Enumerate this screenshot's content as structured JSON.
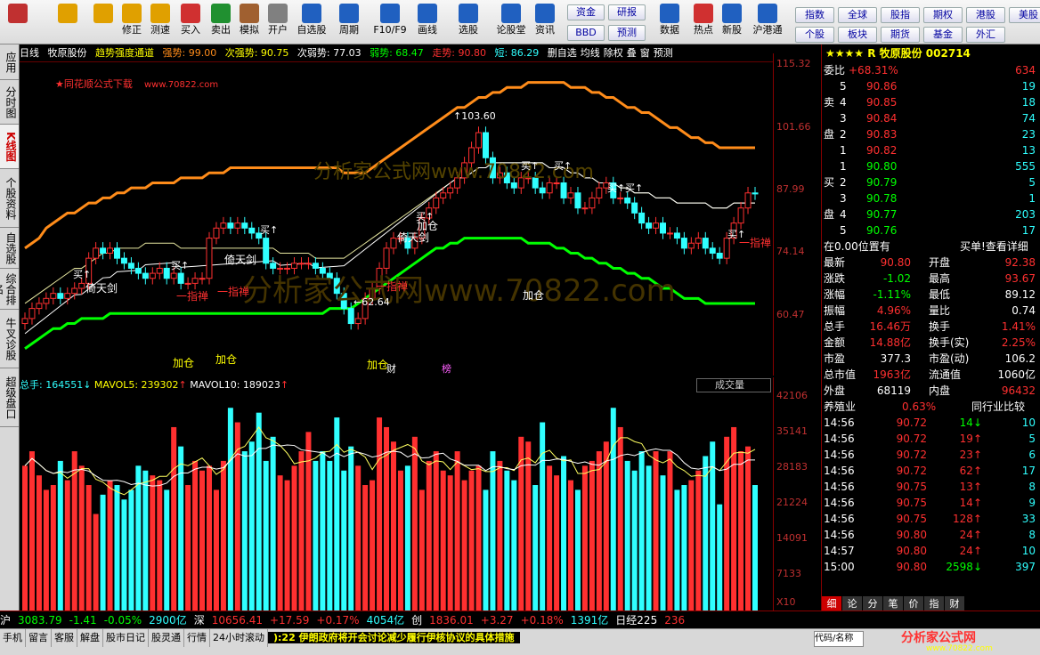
{
  "colors": {
    "up": "#ff3030",
    "down": "#30ffff",
    "green": "#00ff00",
    "yellow": "#ffff00",
    "orange": "#ff8c1a",
    "white": "#ffffff"
  },
  "toolbar": {
    "buttons": [
      {
        "id": "logo",
        "label": "",
        "icon": "logo-icon",
        "color": "#c03030"
      },
      {
        "id": "back",
        "label": "",
        "icon": "back-arrow-icon",
        "color": "#e0a000"
      },
      {
        "id": "updown",
        "label": "",
        "icon": "up-down-icon",
        "color": "#e0a000"
      },
      {
        "id": "repair",
        "label": "修正",
        "icon": "repair-icon",
        "color": "#e0a000"
      },
      {
        "id": "speedtest",
        "label": "测速",
        "icon": "clock-icon",
        "color": "#e0a000"
      },
      {
        "id": "buy",
        "label": "买入",
        "icon": "buy-icon",
        "color": "#d03030"
      },
      {
        "id": "sell",
        "label": "卖出",
        "icon": "sell-icon",
        "color": "#209030"
      },
      {
        "id": "simulate",
        "label": "模拟",
        "icon": "hammer-icon",
        "color": "#a06030"
      },
      {
        "id": "open",
        "label": "开户",
        "icon": "lock-icon",
        "color": "#808080"
      },
      {
        "id": "watchlist",
        "label": "自选股",
        "icon": "star-icon",
        "color": "#2060c0"
      },
      {
        "id": "period",
        "label": "周期",
        "icon": "clock-icon",
        "color": "#2060c0"
      },
      {
        "id": "f10",
        "label": "F10/F9",
        "icon": "f10-icon",
        "color": "#2060c0"
      },
      {
        "id": "draw",
        "label": "画线",
        "icon": "pen-icon",
        "color": "#2060c0"
      },
      {
        "id": "select",
        "label": "选股",
        "icon": "select-icon",
        "color": "#2060c0"
      },
      {
        "id": "discuss",
        "label": "论股堂",
        "icon": "discuss-icon",
        "color": "#2060c0"
      },
      {
        "id": "info",
        "label": "资讯",
        "icon": "info-icon",
        "color": "#2060c0"
      },
      {
        "id": "data",
        "label": "数据",
        "icon": "pe-icon",
        "color": "#2060c0"
      },
      {
        "id": "hot",
        "label": "热点",
        "icon": "fire-icon",
        "color": "#d03030"
      },
      {
        "id": "newshare",
        "label": "新股",
        "icon": "newshare-icon",
        "color": "#2060c0"
      },
      {
        "id": "hkconnect",
        "label": "沪港通",
        "icon": "hk-icon",
        "color": "#2060c0"
      }
    ],
    "mid_buttons": [
      "资金",
      "研报",
      "BBD",
      "预测"
    ],
    "right_buttons": [
      "指数",
      "全球",
      "股指",
      "期权",
      "港股",
      "美股",
      "个股",
      "板块",
      "期货",
      "基金",
      "外汇"
    ]
  },
  "sidebar": {
    "tabs": [
      "应用",
      "分时图",
      "K线图",
      "个股资料",
      "自选股",
      "综合排名",
      "牛叉诊股",
      "超级盘口"
    ],
    "active": 2
  },
  "infobar": {
    "period": "日线",
    "stock": "牧原股份",
    "indicator": "趋势强度通道",
    "strong": "强势: 99.00",
    "substrong": "次强势: 90.75",
    "subweak": "次弱势: 77.03",
    "weak": "弱势: 68.47",
    "trend": "走势: 90.80",
    "short": "短: 86.29",
    "tools": [
      "删自选",
      "均线",
      "除权",
      "叠",
      "窗",
      "预测"
    ]
  },
  "chart": {
    "watermark_top": "★同花顺公式下载",
    "watermark_url": "www.70822.com",
    "watermark_big": "分析家公式网www.70822.com",
    "high_label": "103.60",
    "low_label": "62.64",
    "annotations": {
      "buy": "买",
      "yitian": "倚天剑",
      "yizhi": "一指禅",
      "jiacang": "加仓",
      "cai": "财",
      "bang": "榜"
    },
    "yaxis": [
      "115.32",
      "101.66",
      "87.99",
      "74.14",
      "60.47"
    ]
  },
  "chart_data": {
    "type": "candlestick",
    "ylim": [
      55,
      117
    ],
    "close": [
      66,
      68,
      69,
      70,
      71,
      70,
      71,
      72,
      73,
      78,
      80,
      79,
      80,
      78,
      77,
      76,
      75,
      74,
      75,
      76,
      74,
      75,
      73,
      73,
      74,
      74,
      82,
      84,
      85,
      84,
      85,
      84,
      83,
      82,
      77,
      76,
      76,
      76,
      77,
      77,
      77,
      76,
      75,
      74,
      71,
      68,
      65,
      66,
      70,
      72,
      76,
      80,
      82,
      82,
      80,
      82,
      86,
      88,
      90,
      91,
      92,
      94,
      97,
      100,
      103,
      98,
      94,
      95,
      93,
      92,
      94,
      94,
      92,
      91,
      93,
      93,
      90,
      91,
      88,
      88,
      90,
      92,
      93,
      90,
      90,
      89,
      87,
      85,
      84,
      85,
      83,
      83,
      82,
      80,
      81,
      82,
      80,
      79,
      78,
      82,
      85,
      88,
      91,
      90.8
    ],
    "upper": [
      80,
      81,
      82,
      84,
      85,
      86,
      87,
      87,
      88,
      89,
      89,
      90,
      90,
      91,
      91,
      92,
      92,
      92,
      93,
      93,
      93,
      93,
      94,
      94,
      94,
      94,
      95,
      95,
      95,
      96,
      96,
      96,
      96,
      96,
      96,
      96,
      96,
      96,
      96,
      96,
      96,
      96,
      96,
      96,
      96,
      95,
      95,
      95,
      95,
      96,
      97,
      98,
      99,
      100,
      101,
      102,
      103,
      104,
      105,
      106,
      107,
      108,
      108,
      109,
      110,
      110,
      111,
      111,
      112,
      112,
      112,
      113,
      113,
      113,
      113,
      113,
      113,
      112,
      112,
      112,
      111,
      111,
      110,
      110,
      109,
      108,
      108,
      107,
      107,
      106,
      105,
      104,
      104,
      103,
      102,
      102,
      101,
      101,
      100,
      100,
      100,
      100,
      100,
      100
    ],
    "middle": [
      69,
      70,
      71,
      72,
      73,
      74,
      75,
      76,
      76,
      77,
      78,
      79,
      79,
      80,
      80,
      80,
      80,
      81,
      81,
      81,
      81,
      81,
      80,
      80,
      80,
      80,
      80,
      80,
      80,
      80,
      80,
      80,
      80,
      80,
      80,
      80,
      79,
      79,
      79,
      79,
      79,
      78,
      78,
      78,
      78,
      78,
      79,
      80,
      81,
      82,
      83,
      84,
      85,
      86,
      87,
      88,
      89,
      90,
      91,
      92,
      93,
      94,
      94,
      95,
      96,
      96,
      97,
      97,
      97,
      97,
      97,
      97,
      97,
      97,
      96,
      96,
      96,
      95,
      95,
      94,
      94,
      93,
      93,
      93,
      92,
      92,
      91,
      91,
      91,
      90,
      90,
      90,
      89,
      89,
      89,
      89,
      89,
      88,
      88,
      88,
      89,
      89,
      89,
      89
    ],
    "lower": [
      60,
      61,
      62,
      63,
      64,
      64,
      65,
      65,
      66,
      66,
      66,
      66,
      67,
      67,
      67,
      67,
      67,
      67,
      67,
      67,
      67,
      67,
      67,
      67,
      67,
      67,
      67,
      67,
      67,
      67,
      67,
      67,
      67,
      67,
      67,
      67,
      67,
      67,
      67,
      67,
      67,
      67,
      67,
      68,
      68,
      68,
      68,
      69,
      70,
      71,
      72,
      73,
      74,
      75,
      76,
      77,
      78,
      79,
      80,
      80,
      81,
      81,
      82,
      82,
      82,
      82,
      82,
      82,
      82,
      82,
      82,
      81,
      81,
      81,
      81,
      80,
      80,
      79,
      79,
      78,
      78,
      77,
      77,
      76,
      76,
      75,
      75,
      74,
      74,
      73,
      72,
      72,
      71,
      70,
      70,
      70,
      69,
      69,
      69,
      69,
      69,
      69,
      69,
      69
    ],
    "volume": [
      30,
      33,
      28,
      25,
      26,
      31,
      27,
      33,
      30,
      26,
      20,
      24,
      27,
      26,
      23,
      25,
      30,
      29,
      28,
      27,
      25,
      38,
      34,
      26,
      31,
      29,
      30,
      25,
      31,
      42,
      39,
      33,
      35,
      41,
      31,
      36,
      28,
      27,
      30,
      33,
      37,
      31,
      33,
      31,
      40,
      29,
      34,
      30,
      26,
      27,
      40,
      38,
      35,
      29,
      30,
      36,
      25,
      31,
      33,
      29,
      28,
      33,
      27,
      29,
      30,
      25,
      33,
      31,
      29,
      27,
      36,
      35,
      26,
      39,
      30,
      28,
      32,
      27,
      25,
      30,
      31,
      33,
      35,
      42,
      38,
      31,
      29,
      33,
      30,
      33,
      28,
      33,
      25,
      26,
      27,
      29,
      32,
      35,
      22,
      36,
      38,
      33,
      34,
      26
    ],
    "vol_yaxis": [
      "42106",
      "35141",
      "28183",
      "21224",
      "14091",
      "7133"
    ],
    "vol_unit": "X10"
  },
  "volhdr": {
    "total": "总手: 164551",
    "ma5": "MAVOL5: 239302",
    "ma10": "MAVOL10: 189023",
    "dropdown": "成交量"
  },
  "rightpanel": {
    "title": "R 牧原股份 002714",
    "webi": [
      "委比",
      "+68.31%",
      "634"
    ],
    "sell": [
      [
        "5",
        "90.86",
        "19"
      ],
      [
        "4",
        "90.85",
        "18"
      ],
      [
        "3",
        "90.84",
        "74"
      ],
      [
        "2",
        "90.83",
        "23"
      ],
      [
        "1",
        "90.82",
        "13"
      ]
    ],
    "buy": [
      [
        "1",
        "90.80",
        "555"
      ],
      [
        "2",
        "90.79",
        "5"
      ],
      [
        "3",
        "90.78",
        "1"
      ],
      [
        "4",
        "90.77",
        "203"
      ],
      [
        "5",
        "90.76",
        "17"
      ]
    ],
    "sell_label": "卖盘",
    "buy_label": "买盘",
    "pos": "在0.00位置有",
    "pos_right": "买单!查看详细",
    "quote": [
      [
        "最新",
        "90.80",
        "开盘",
        "92.38"
      ],
      [
        "涨跌",
        "-1.02",
        "最高",
        "93.67"
      ],
      [
        "涨幅",
        "-1.11%",
        "最低",
        "89.12"
      ],
      [
        "振幅",
        "4.96%",
        "量比",
        "0.74"
      ],
      [
        "总手",
        "16.46万",
        "换手",
        "1.41%"
      ],
      [
        "金额",
        "14.88亿",
        "换手(实)",
        "2.25%"
      ],
      [
        "市盈",
        "377.3",
        "市盈(动)",
        "106.2"
      ],
      [
        "总市值",
        "1963亿",
        "流通值",
        "1060亿"
      ],
      [
        "外盘",
        "68119",
        "内盘",
        "96432"
      ]
    ],
    "industry": [
      "养殖业",
      "0.63%",
      "同行业比较"
    ],
    "ticks": [
      [
        "14:56",
        "90.72",
        "14",
        "down",
        "10"
      ],
      [
        "14:56",
        "90.72",
        "19",
        "up",
        "5"
      ],
      [
        "14:56",
        "90.72",
        "23",
        "up",
        "6"
      ],
      [
        "14:56",
        "90.72",
        "62",
        "up",
        "17"
      ],
      [
        "14:56",
        "90.75",
        "13",
        "up",
        "8"
      ],
      [
        "14:56",
        "90.75",
        "14",
        "up",
        "9"
      ],
      [
        "14:56",
        "90.75",
        "128",
        "up",
        "33"
      ],
      [
        "14:56",
        "90.80",
        "24",
        "up",
        "8"
      ],
      [
        "14:57",
        "90.80",
        "24",
        "up",
        "10"
      ],
      [
        "15:00",
        "90.80",
        "2598",
        "down",
        "397"
      ]
    ],
    "bottom_tabs": [
      "细",
      "论",
      "分",
      "笔",
      "价",
      "指",
      "财"
    ]
  },
  "statusbar": {
    "sh": "沪",
    "sh_val": "3083.79",
    "sh_chg": "-1.41",
    "sh_pct": "-0.05%",
    "sh_amt": "2900亿",
    "sz": "深",
    "sz_val": "10656.41",
    "sz_chg": "+17.59",
    "sz_pct": "+0.17%",
    "sz_amt": "4054亿",
    "cy": "创",
    "cy_val": "1836.01",
    "cy_chg": "+3.27",
    "cy_pct": "+0.18%",
    "cy_amt": "1391亿",
    "ext": "日经225",
    "ext_val": "236"
  },
  "bottombar": {
    "tabs": [
      "手机",
      "留言",
      "客服",
      "解盘",
      "股市日记",
      "股灵通",
      "行情",
      "24小时滚动"
    ],
    "news": "):22 伊朗政府将开会讨论减少履行伊核协议的具体措施",
    "right": "代码/名称",
    "brand": "分析家公式网",
    "brand_url": "www.70822.com"
  }
}
